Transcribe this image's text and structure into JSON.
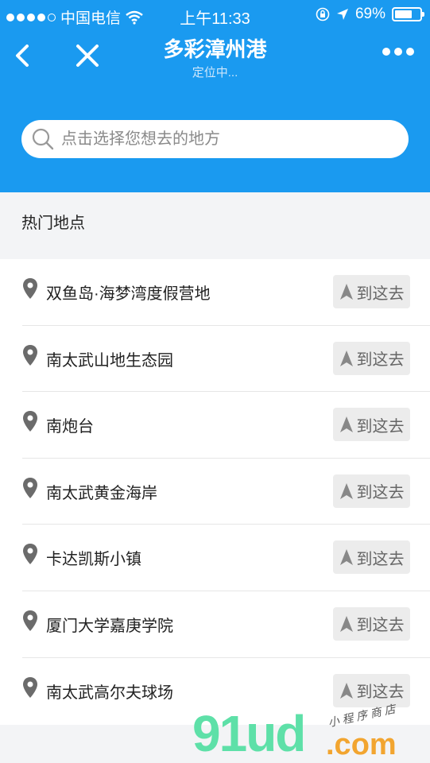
{
  "status_bar": {
    "carrier": "中国电信",
    "time": "上午11:33",
    "battery_percent": "69%",
    "battery_level": 0.69
  },
  "nav": {
    "title": "多彩漳州港",
    "subtitle": "定位中..."
  },
  "search": {
    "placeholder": "点击选择您想去的地方"
  },
  "section": {
    "title": "热门地点"
  },
  "places": [
    {
      "name": "双鱼岛·海梦湾度假营地",
      "action": "到这去"
    },
    {
      "name": "南太武山地生态园",
      "action": "到这去"
    },
    {
      "name": "南炮台",
      "action": "到这去"
    },
    {
      "name": "南太武黄金海岸",
      "action": "到这去"
    },
    {
      "name": "卡达凯斯小镇",
      "action": "到这去"
    },
    {
      "name": "厦门大学嘉庚学院",
      "action": "到这去"
    },
    {
      "name": "南太武高尔夫球场",
      "action": "到这去"
    }
  ],
  "watermark": {
    "main": "91ud",
    "domain": ".com",
    "tagline": "小程序商店"
  },
  "colors": {
    "header_bg": "#1a9af0",
    "section_bg": "#f3f4f6",
    "button_bg": "#ececec"
  }
}
